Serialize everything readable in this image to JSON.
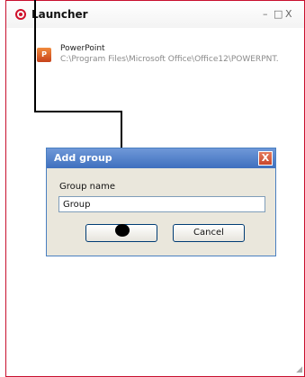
{
  "window": {
    "title": "Launcher",
    "minimize_label": "–",
    "maximize_label": "□",
    "close_label": "X"
  },
  "entries": [
    {
      "icon": "powerpoint-icon",
      "name": "PowerPoint",
      "path": "C:\\Program Files\\Microsoft Office\\Office12\\POWERPNT.",
      "icon_text": "P"
    }
  ],
  "dialog": {
    "title": "Add group",
    "close_label": "X",
    "field_label": "Group name",
    "field_value": "Group",
    "ok_label": "",
    "cancel_label": "Cancel"
  },
  "colors": {
    "accent_red": "#c8102e",
    "dialog_title_blue": "#3f70be"
  }
}
